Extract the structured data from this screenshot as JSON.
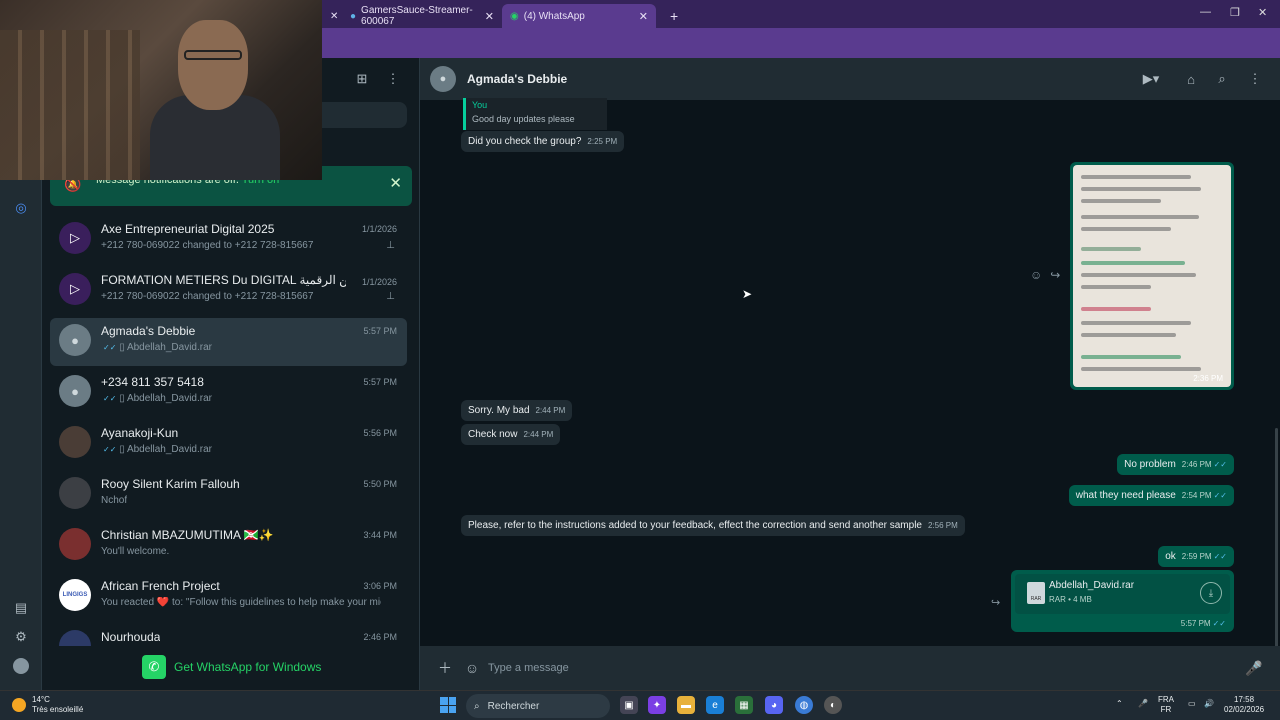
{
  "browser": {
    "tabs": [
      {
        "label": "GamersSauce-Streamer-600067",
        "active": false
      },
      {
        "label": "(4) WhatsApp",
        "active": true
      }
    ],
    "new_tab": "+"
  },
  "notification": {
    "text": "Message notifications are off.",
    "link": "Turn on"
  },
  "chats": [
    {
      "name": "Axe Entrepreneuriat Digital 2025",
      "time": "1/1/2026",
      "preview": "+212 780-069022 changed to +212 728-815667",
      "pinned": true,
      "selected": false
    },
    {
      "name": "FORMATION METIERS Du DIGITAL تكوينية المهن الرقمية",
      "time": "1/1/2026",
      "preview": "+212 780-069022 changed to +212 728-815667",
      "pinned": true,
      "selected": false
    },
    {
      "name": "Agmada's Debbie",
      "time": "5:57 PM",
      "preview": "Abdellah_David.rar",
      "pinned": false,
      "selected": true
    },
    {
      "name": "+234 811 357 5418",
      "time": "5:57 PM",
      "preview": "Abdellah_David.rar",
      "pinned": false,
      "selected": false
    },
    {
      "name": "Ayanakoji-Kun",
      "time": "5:56 PM",
      "preview": "Abdellah_David.rar",
      "pinned": false,
      "selected": false
    },
    {
      "name": "Rooy Silent Karim Fallouh",
      "time": "5:50 PM",
      "preview": "Nchof",
      "pinned": false,
      "selected": false
    },
    {
      "name": "Christian MBAZUMUTIMA 🇧🇮✨",
      "time": "3:44 PM",
      "preview": "You'll welcome.",
      "pinned": false,
      "selected": false
    },
    {
      "name": "African French Project",
      "time": "3:06 PM",
      "preview": "You reacted ❤️ to: \"Follow this guidelines to help make your mic vol...",
      "pinned": false,
      "selected": false
    },
    {
      "name": "Nourhouda",
      "time": "2:46 PM",
      "preview": "",
      "pinned": false,
      "selected": false
    }
  ],
  "get_whatsapp": "Get WhatsApp for Windows",
  "conversation": {
    "title": "Agmada's Debbie",
    "quote": {
      "author": "You",
      "text": "Good day updates please"
    },
    "messages": [
      {
        "dir": "in",
        "text": "Did you check the group?",
        "time": "2:25 PM"
      },
      {
        "dir": "in",
        "text": "Sorry. My bad",
        "time": "2:44 PM"
      },
      {
        "dir": "in",
        "text": "Check now",
        "time": "2:44 PM"
      },
      {
        "dir": "out",
        "text": "No problem",
        "time": "2:46 PM"
      },
      {
        "dir": "out",
        "text": "what they need please",
        "time": "2:54 PM"
      },
      {
        "dir": "in",
        "text": "Please, refer to the instructions added to your feedback, effect the correction and send another sample",
        "time": "2:56 PM"
      },
      {
        "dir": "out",
        "text": "ok",
        "time": "2:59 PM"
      }
    ],
    "image_time": "2:36 PM",
    "file": {
      "name": "Abdellah_David.rar",
      "meta": "RAR • 4 MB",
      "time": "5:57 PM",
      "icon_label": "RAR"
    },
    "composer_placeholder": "Type a message"
  },
  "taskbar": {
    "weather_temp": "14°C",
    "weather_desc": "Très ensoleillé",
    "search_label": "Rechercher",
    "lang_top": "FRA",
    "lang_bottom": "FR",
    "clock_time": "17:58",
    "clock_date": "02/02/2026"
  }
}
